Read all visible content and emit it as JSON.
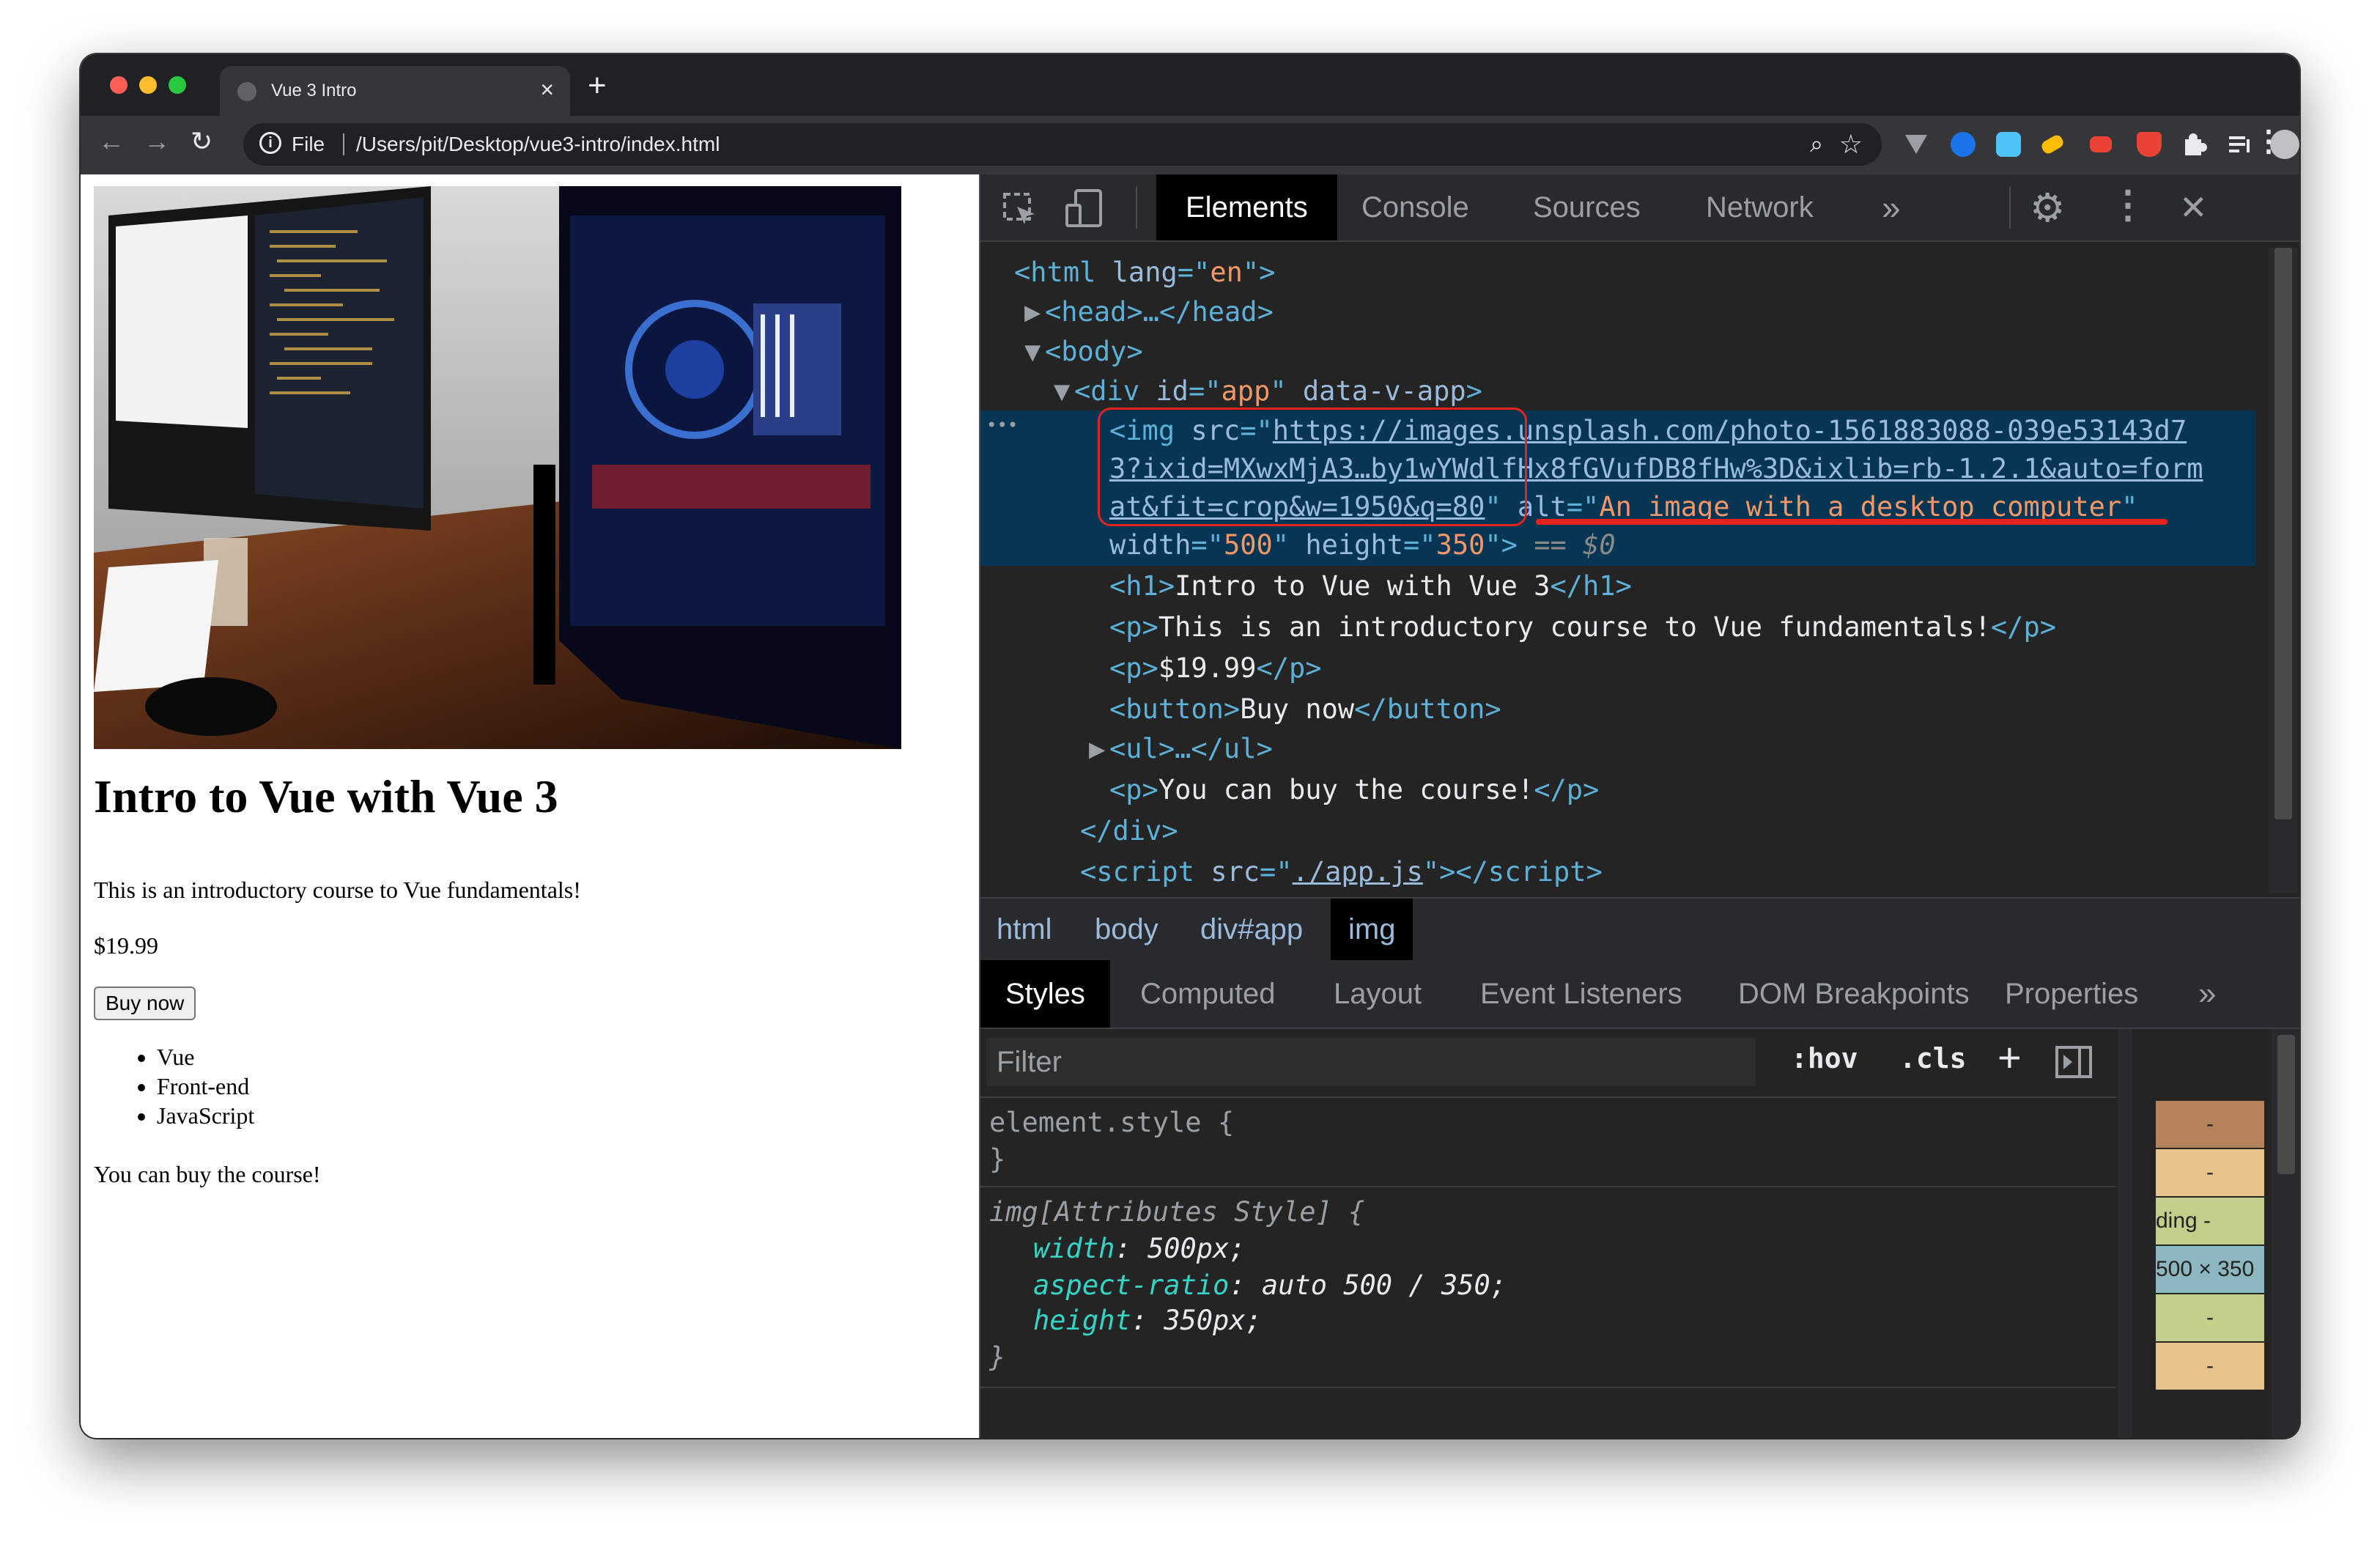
{
  "browser": {
    "tab_title": "Vue 3 Intro",
    "tab_close": "×",
    "new_tab": "+",
    "url_scheme": "File",
    "url": "/Users/pit/Desktop/vue3-intro/index.html",
    "nav": {
      "back": "←",
      "forward": "→",
      "reload": "↻",
      "zoom": "⌕",
      "star": "☆",
      "menu": "⋮"
    },
    "traffic_colors": [
      "#ff5f57",
      "#febc2e",
      "#28c840"
    ],
    "extension_colors": [
      "#9aa0a6",
      "#1a73e8",
      "#4fc3f7",
      "#fbbc04",
      "#ea4335",
      "#ea4335",
      "#e8eaed",
      "#e8eaed",
      "#bdc1c6"
    ]
  },
  "page": {
    "heading": "Intro to Vue with Vue 3",
    "description": "This is an introductory course to Vue fundamentals!",
    "price": "$19.99",
    "buy_button": "Buy now",
    "list": [
      "Vue",
      "Front-end",
      "JavaScript"
    ],
    "footer_text": "You can buy the course!"
  },
  "devtools": {
    "tabs": [
      "Elements",
      "Console",
      "Sources",
      "Network"
    ],
    "more_tabs": "»",
    "close": "✕",
    "settings": "⚙",
    "kebab": "⋮",
    "dom_lines": {
      "html_open": [
        "<html ",
        "lang",
        "=\"",
        "en",
        "\">"
      ],
      "head": "<head>…</head>",
      "body": "<body>",
      "div_open": [
        "<div ",
        "id",
        "=\"",
        "app",
        "\" ",
        "data-v-app",
        ">"
      ],
      "img_src_1": "https://images.unsplash.com/photo-1561883088-039e53143d7",
      "img_src_2": "3?ixid=MXwxMjA3…by1wYWdlfHx8fGVufDB8fHw%3D&ixlib=rb-1.2.1&auto=form",
      "img_src_3": "at&fit=crop&w=1950&q=80",
      "img_alt": "An image with a desktop computer",
      "img_width": "500",
      "img_height": "350",
      "dollar_zero": "== $0",
      "h1": "Intro to Vue with Vue 3",
      "p1": "This is an introductory course to Vue fundamentals!",
      "p2": "$19.99",
      "button": "Buy now",
      "ul": "<ul>…</ul>",
      "p3": "You can buy the course!",
      "div_close": "</div>",
      "script_src": "./app.js",
      "ellipsis": "•••"
    },
    "breadcrumbs": [
      "html",
      "body",
      "div#app",
      "img"
    ],
    "style_tabs": [
      "Styles",
      "Computed",
      "Layout",
      "Event Listeners",
      "DOM Breakpoints",
      "Properties"
    ],
    "style_more": "»",
    "filter_placeholder": "Filter",
    "hov": ":hov",
    "cls": ".cls",
    "plus": "+",
    "element_style": "element.style {",
    "close_brace": "}",
    "attr_rule": "img[Attributes Style] {",
    "props": [
      {
        "name": "width",
        "value": "500px;"
      },
      {
        "name": "aspect-ratio",
        "value": "auto 500 / 350;"
      },
      {
        "name": "height",
        "value": "350px;"
      }
    ],
    "box_model": [
      {
        "label": "-",
        "color": "#b5835a"
      },
      {
        "label": "-",
        "color": "#e6c48b"
      },
      {
        "label": "ding -",
        "color": "#c2cf8a"
      },
      {
        "label": "500 × 350",
        "color": "#8cb6c0"
      },
      {
        "label": "-",
        "color": "#c2cf8a"
      },
      {
        "label": "-",
        "color": "#e6c48b"
      }
    ],
    "highlight_colors": {
      "selection": "#073655",
      "annotation": "#e5231e"
    }
  }
}
